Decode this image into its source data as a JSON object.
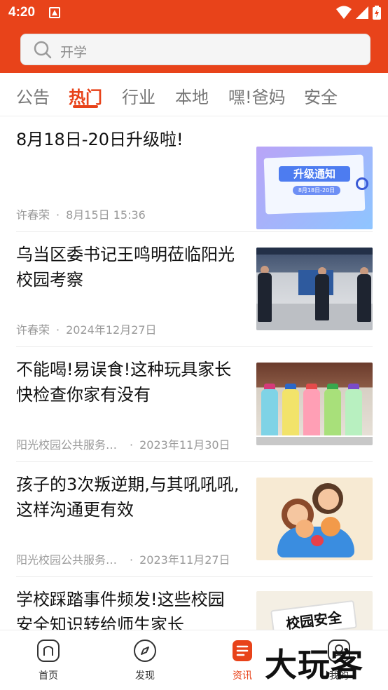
{
  "status_bar": {
    "time": "4:20"
  },
  "search": {
    "placeholder": "开学"
  },
  "tabs": [
    {
      "label": "公告",
      "active": false
    },
    {
      "label": "热门",
      "active": true
    },
    {
      "label": "行业",
      "active": false
    },
    {
      "label": "本地",
      "active": false
    },
    {
      "label": "嘿!爸妈",
      "active": false
    },
    {
      "label": "安全",
      "active": false
    }
  ],
  "articles": [
    {
      "title": "8月18日-20日升级啦!",
      "author": "许春荣",
      "date": "8月15日 15:36",
      "thumb": {
        "headline": "升级通知",
        "subtext": "8月18日-20日"
      }
    },
    {
      "title": "乌当区委书记王鸣明莅临阳光校园考察",
      "author": "许春荣",
      "date": "2024年12月27日"
    },
    {
      "title": "不能喝!易误食!这种玩具家长快检查你家有没有",
      "author": "阳光校园公共服务…",
      "date": "2023年11月30日"
    },
    {
      "title": "孩子的3次叛逆期,与其吼吼吼,这样沟通更有效",
      "author": "阳光校园公共服务…",
      "date": "2023年11月27日"
    },
    {
      "title": "学校踩踏事件频发!这些校园安全知识转给师生家长",
      "thumb": {
        "headline": "校园安全"
      }
    }
  ],
  "bottom_nav": [
    {
      "label": "首页",
      "icon": "home-icon",
      "active": false
    },
    {
      "label": "发现",
      "icon": "compass-icon",
      "active": false
    },
    {
      "label": "资讯",
      "icon": "news-icon",
      "active": true
    },
    {
      "label": "我的",
      "icon": "profile-icon",
      "active": false
    }
  ],
  "watermark": "大玩客",
  "colors": {
    "brand": "#e8431a",
    "text": "#111111",
    "meta": "#9a9a9a"
  }
}
